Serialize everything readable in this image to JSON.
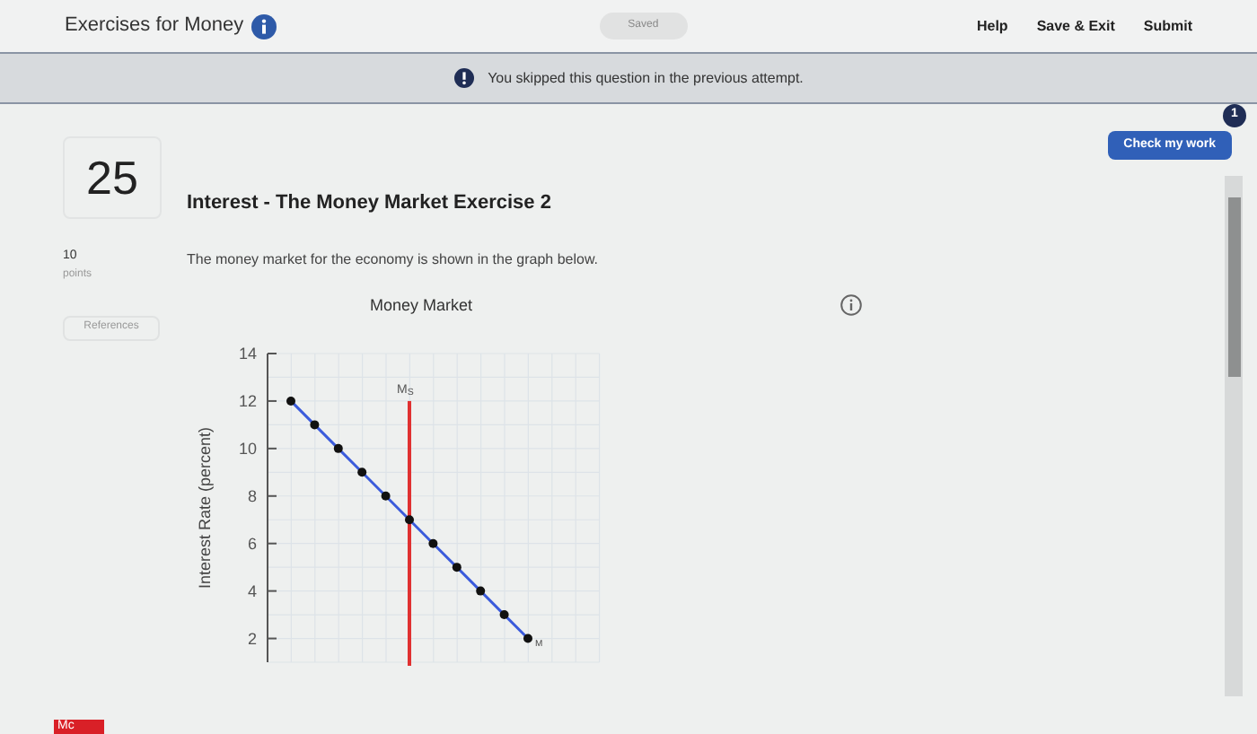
{
  "header": {
    "title": "Exercises for Money",
    "status": "Saved",
    "links": [
      "Help",
      "Save & Exit",
      "Submit"
    ]
  },
  "notice": {
    "text": "You skipped this question in the previous attempt."
  },
  "check_button": {
    "label": "Check my work",
    "badge": "1"
  },
  "question": {
    "number": "25",
    "points": "10",
    "points_label": "points",
    "references": "References",
    "title": "Interest - The Money Market Exercise 2",
    "prompt": "The money market for the economy is shown in the graph below."
  },
  "chart": {
    "title": "Money Market",
    "chart_data": {
      "type": "line",
      "ylabel": "Interest Rate (percent)",
      "ylim": [
        1,
        14
      ],
      "yticks": [
        2,
        4,
        6,
        8,
        10,
        12,
        14
      ],
      "grid": true,
      "series": [
        {
          "name": "M",
          "color": "#3b5bdb",
          "marker": "circle",
          "values": [
            12,
            11,
            10,
            9,
            8,
            7,
            6,
            5,
            4,
            3,
            2
          ]
        }
      ]
    },
    "supply_line": {
      "label": "M$_{S}$",
      "color": "#e03131"
    }
  },
  "footer": {
    "logo": "Mc"
  }
}
